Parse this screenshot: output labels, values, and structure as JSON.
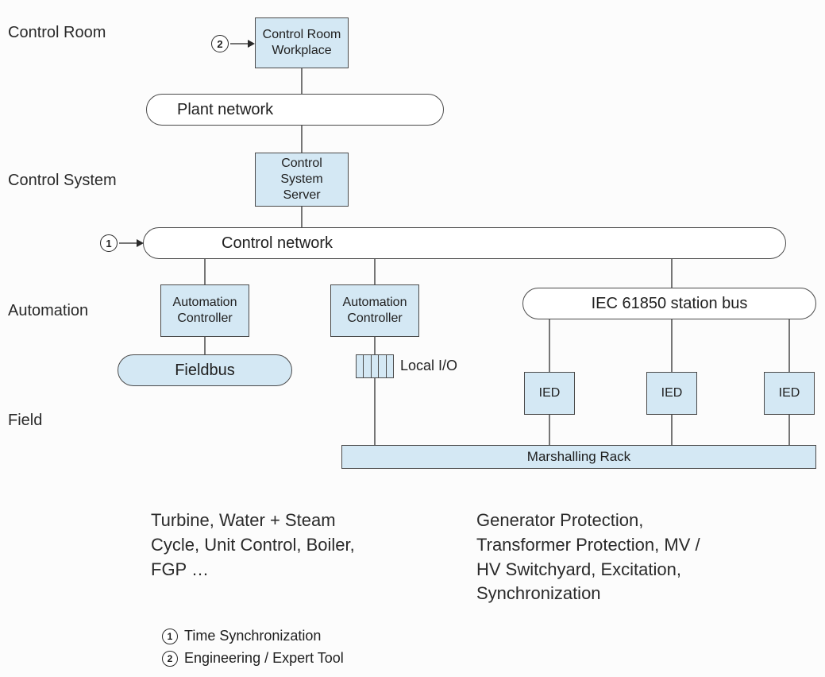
{
  "rowLabels": {
    "controlRoom": "Control Room",
    "controlSystem": "Control System",
    "automation": "Automation",
    "field": "Field"
  },
  "boxes": {
    "controlRoomWorkplace": "Control Room Workplace",
    "controlSystemServer": "Control System Server",
    "automationController": "Automation Controller",
    "ied": "IED",
    "marshallingRack": "Marshalling Rack"
  },
  "pills": {
    "plantNetwork": "Plant network",
    "controlNetwork": "Control network",
    "fieldbus": "Fieldbus",
    "iecStationBus": "IEC 61850 station bus"
  },
  "labels": {
    "localIO": "Local I/O"
  },
  "markers": {
    "one": "1",
    "two": "2"
  },
  "legend": {
    "one": "Time Synchronization",
    "two": "Engineering / Expert Tool"
  },
  "notes": {
    "left": "Turbine, Water + Steam Cycle, Unit Control, Boiler, FGP …",
    "right": "Generator Protection, Transformer Protection, MV / HV Switchyard, Excitation, Synchronization"
  }
}
